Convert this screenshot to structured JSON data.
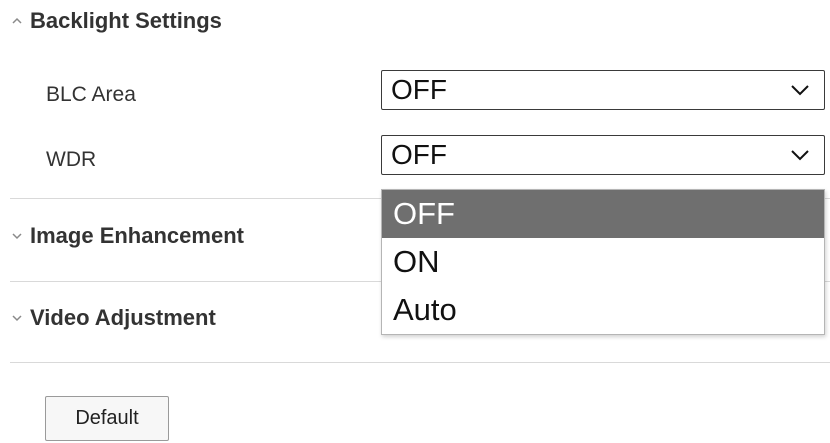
{
  "sections": {
    "backlight": {
      "title": "Backlight Settings",
      "state": "expanded",
      "fields": [
        {
          "label": "BLC Area",
          "value": "OFF"
        },
        {
          "label": "WDR",
          "value": "OFF"
        }
      ]
    },
    "image_enhancement": {
      "title": "Image Enhancement",
      "state": "collapsed"
    },
    "video_adjustment": {
      "title": "Video Adjustment",
      "state": "collapsed"
    }
  },
  "wdr_dropdown": {
    "open": true,
    "options": [
      "OFF",
      "ON",
      "Auto"
    ],
    "highlighted": "OFF"
  },
  "buttons": {
    "default_label": "Default"
  },
  "icons": {
    "expanded": "chevron-up-icon",
    "collapsed": "chevron-down-icon",
    "select_arrow": "chevron-down-icon"
  },
  "colors": {
    "highlight_bg": "#6f6f6f",
    "divider": "#d9d9d9",
    "select_border": "#3a3a3a"
  }
}
